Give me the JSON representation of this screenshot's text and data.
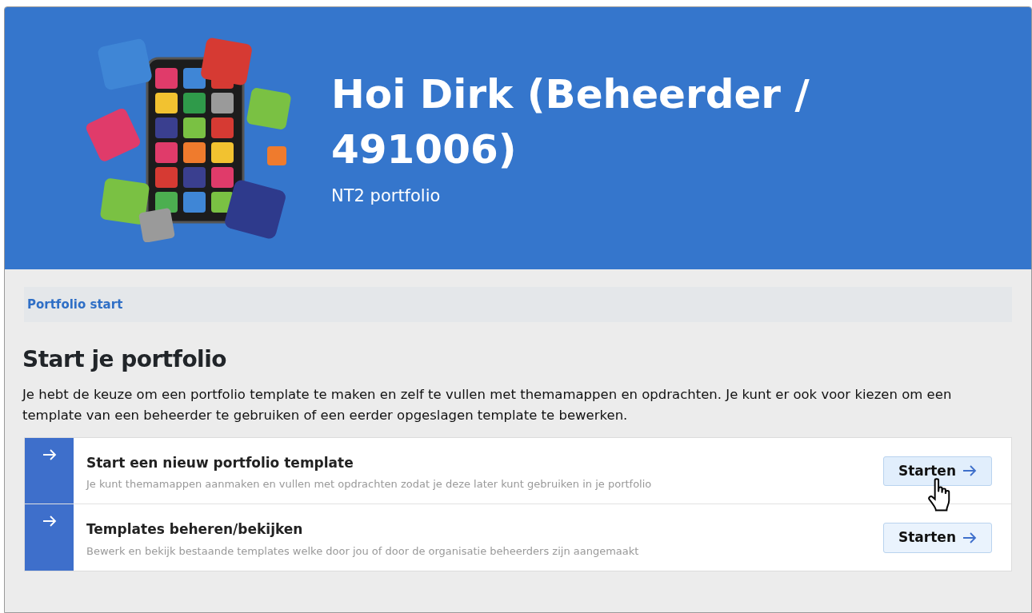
{
  "header": {
    "greeting": "Hoi Dirk (Beheerder / 491006)",
    "subtitle": "NT2 portfolio"
  },
  "breadcrumb": "Portfolio start",
  "heading": "Start je portfolio",
  "intro": "Je hebt de keuze om een portfolio template te maken en zelf te vullen met themamappen en opdrachten. Je kunt er ook voor kiezen om een template van een beheerder te gebruiken of een eerder opgeslagen template te bewerken.",
  "options": [
    {
      "title": "Start een nieuw portfolio template",
      "description": "Je kunt themamappen aanmaken en vullen met opdrachten zodat je deze later kunt gebruiken in je portfolio",
      "button": "Starten",
      "hovered": true
    },
    {
      "title": "Templates beheren/bekijken",
      "description": "Bewerk en bekijk bestaande templates welke door jou of door de organisatie beheerders zijn aangemaakt",
      "button": "Starten",
      "hovered": false
    }
  ]
}
